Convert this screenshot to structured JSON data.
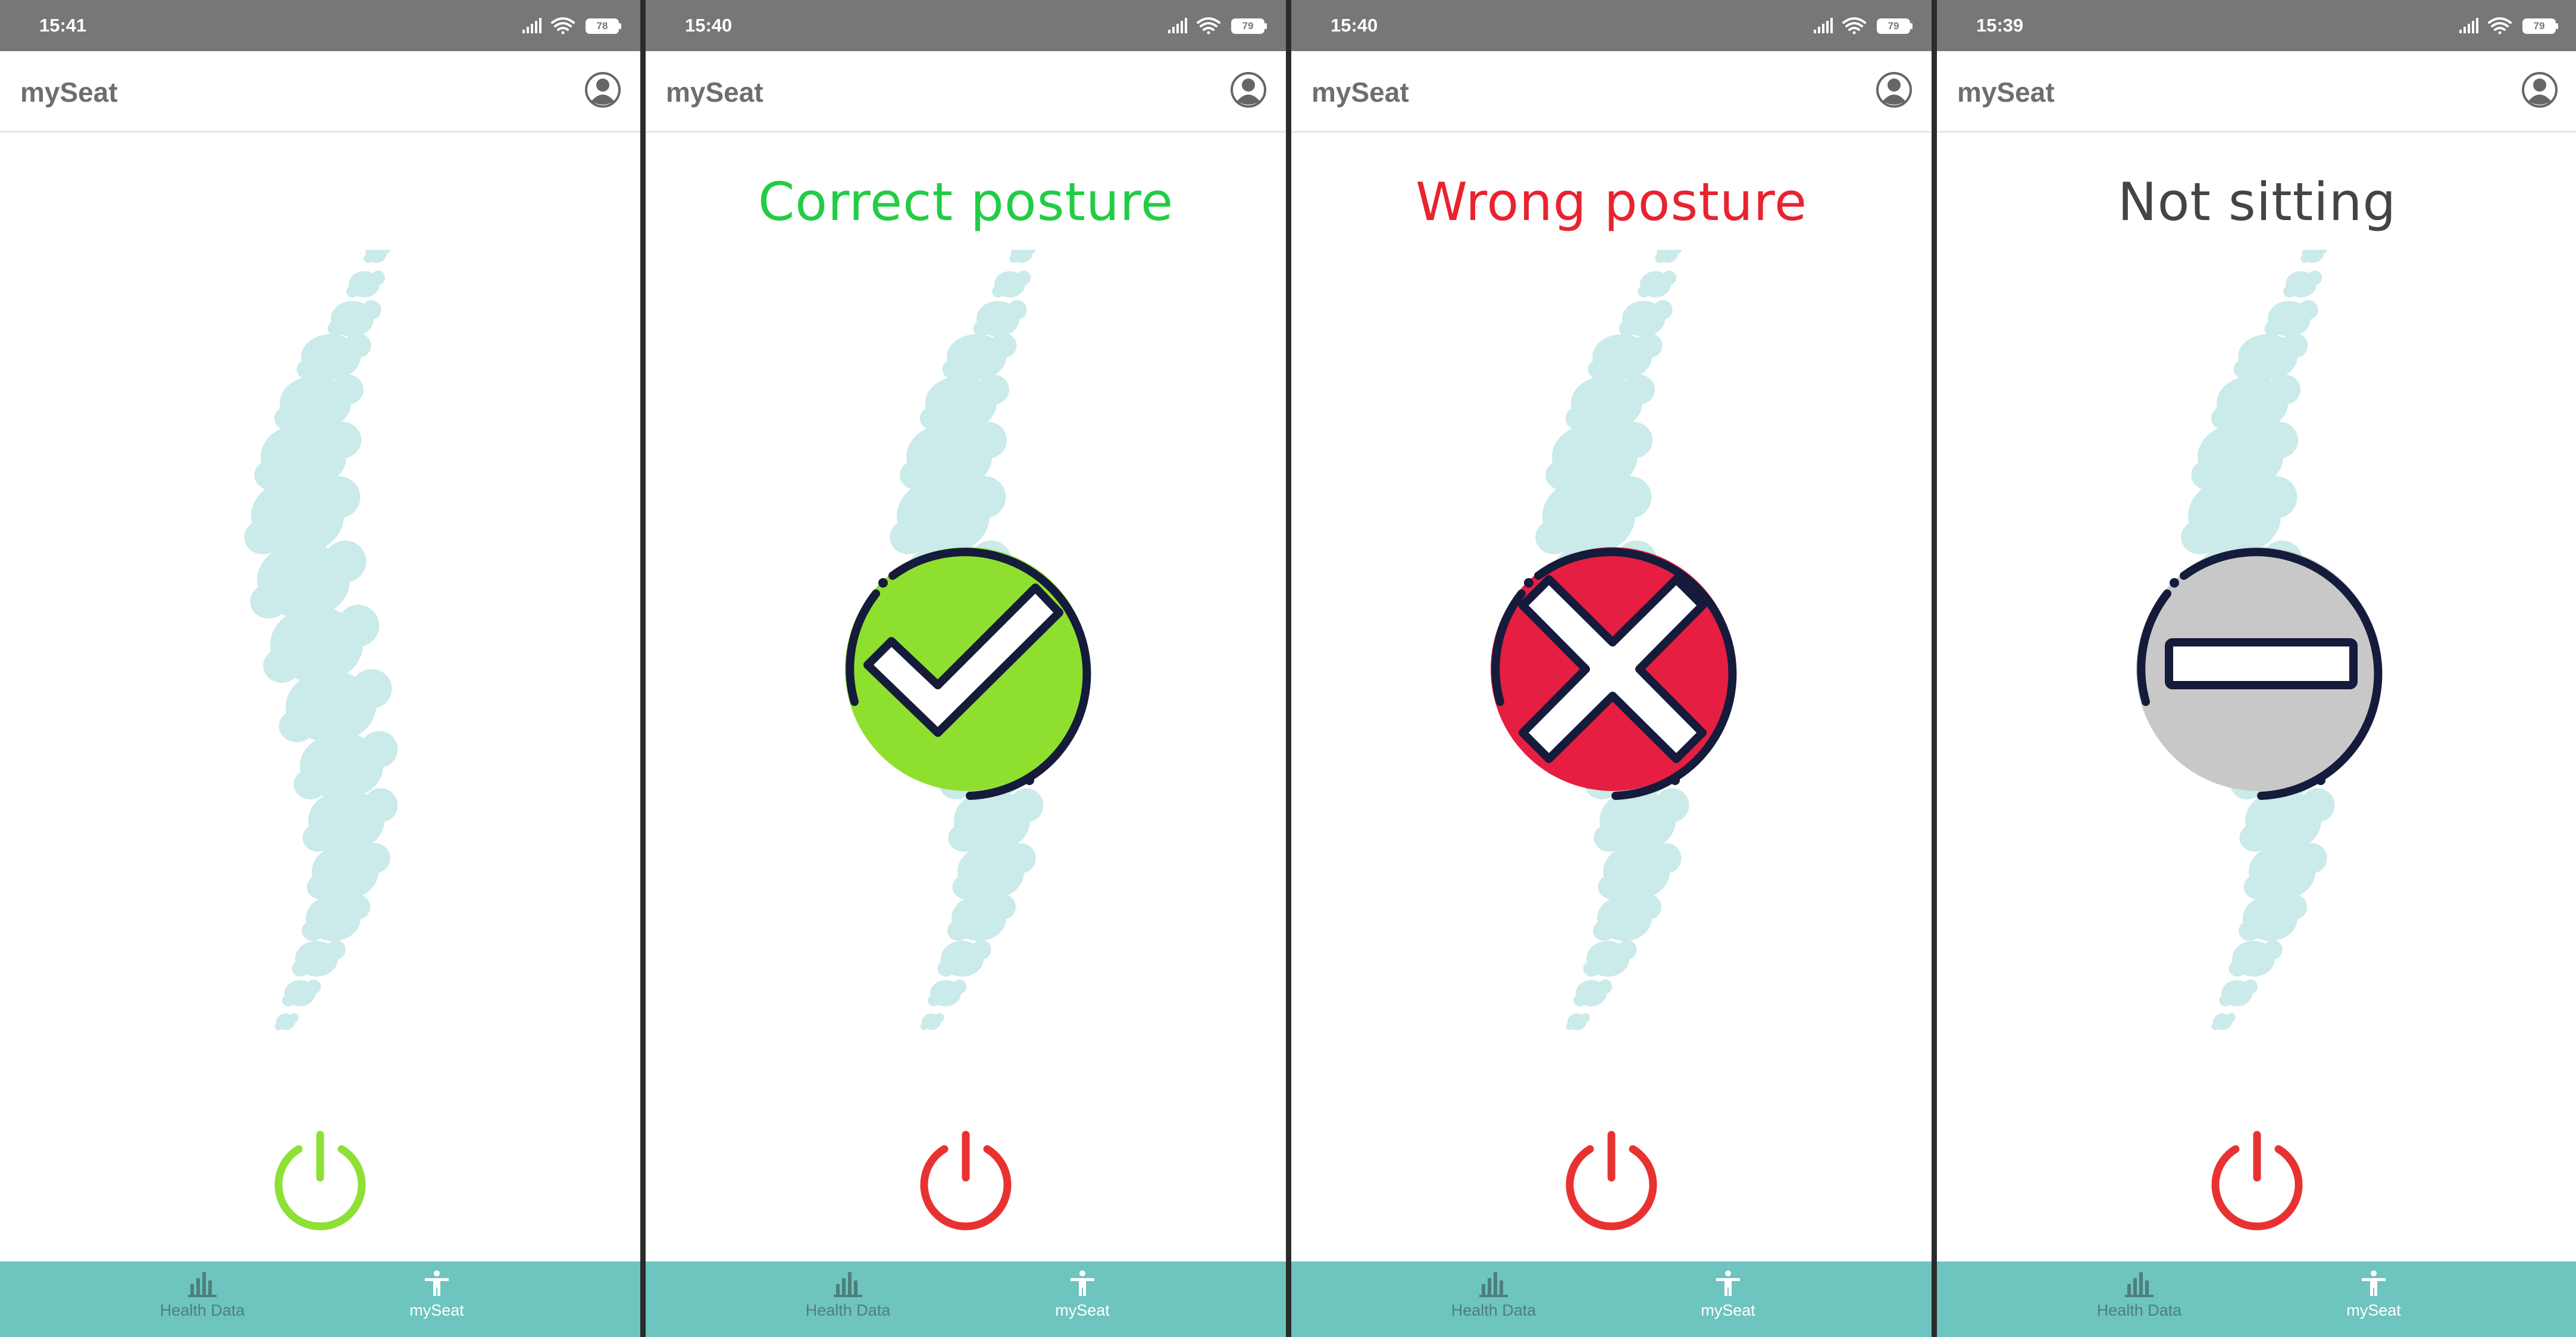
{
  "app": {
    "title": "mySeat",
    "colors": {
      "nav_background": "#6ec4bf",
      "spine": "#cbeaea",
      "correct": "#22cc44",
      "wrong": "#e8232f",
      "neutral": "#444444",
      "power_on": "#8ee036",
      "power_off": "#e83232"
    }
  },
  "screens": [
    {
      "status_bar": {
        "time": "15:41",
        "battery": "78"
      },
      "title": "mySeat",
      "heading": "",
      "state": "idle",
      "power_state": "on",
      "nav": {
        "health_label": "Health Data",
        "myseat_label": "mySeat",
        "active": "mySeat"
      }
    },
    {
      "status_bar": {
        "time": "15:40",
        "battery": "79"
      },
      "title": "mySeat",
      "heading": "Correct posture",
      "heading_color": "#22cc44",
      "state": "correct",
      "icon": "check-icon",
      "power_state": "off",
      "nav": {
        "health_label": "Health Data",
        "myseat_label": "mySeat",
        "active": "mySeat"
      }
    },
    {
      "status_bar": {
        "time": "15:40",
        "battery": "79"
      },
      "title": "mySeat",
      "heading": "Wrong posture",
      "heading_color": "#e8232f",
      "state": "wrong",
      "icon": "cross-icon",
      "power_state": "off",
      "nav": {
        "health_label": "Health Data",
        "myseat_label": "mySeat",
        "active": "mySeat"
      }
    },
    {
      "status_bar": {
        "time": "15:39",
        "battery": "79"
      },
      "title": "mySeat",
      "heading": "Not sitting",
      "heading_color": "#444444",
      "state": "not-sitting",
      "icon": "minus-icon",
      "power_state": "off",
      "nav": {
        "health_label": "Health Data",
        "myseat_label": "mySeat",
        "active": "mySeat"
      }
    }
  ]
}
